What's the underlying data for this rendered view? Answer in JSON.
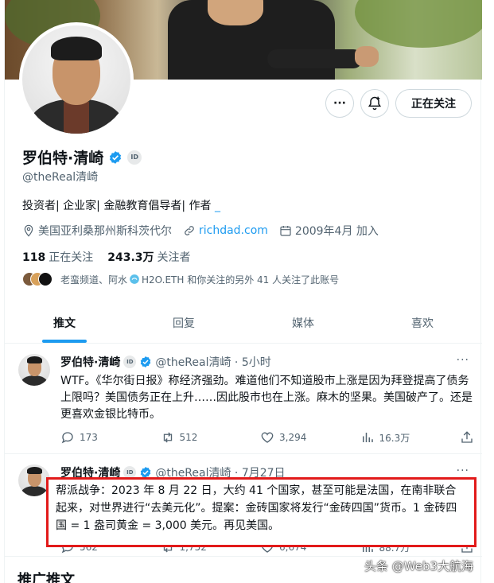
{
  "profile": {
    "name": "罗伯特·清崎",
    "id_badge": "ID",
    "handle": "@theReal清崎",
    "bio": "投资者| 企业家| 金融教育倡导者| 作者 ",
    "bio_link": "_",
    "location": "美国亚利桑那州斯科茨代尔",
    "website": "richdad.com",
    "joined": "2009年4月 加入",
    "following_count": "118",
    "following_label": "正在关注",
    "followers_count": "243.3万",
    "followers_label": "关注者",
    "followed_by": "老蛮频道、阿水",
    "followed_by_2": "H2O.ETH 和你关注的另外 41 人关注了此账号"
  },
  "actions": {
    "more_label": "···",
    "follow_label": "正在关注"
  },
  "tabs": [
    "推文",
    "回复",
    "媒体",
    "喜欢"
  ],
  "tweets": [
    {
      "name": "罗伯特·清崎",
      "handle": "@theReal清崎 · 5小时",
      "more": "···",
      "text": "WTF。《华尔街日报》称经济强劲。难道他们不知道股市上涨是因为拜登提高了债务上限吗？美国债务正在上升……因此股市也在上涨。麻木的坚果。美国破产了。还是更喜欢金银比特币。",
      "replies": "173",
      "retweets": "512",
      "likes": "3,294",
      "views": "16.3万"
    },
    {
      "name": "罗伯特·清崎",
      "handle": "@theReal清崎 · 7月27日",
      "more": "···",
      "text": "帮派战争：2023 年 8 月 22 日，大约 41 个国家，甚至可能是法国，在南非联合起来，对世界进行“去美元化”。提案：金砖国家将发行“金砖四国”货币。1 金砖四国 = 1 盎司黄金 = 3,000 美元。再见美国。",
      "replies": "562",
      "retweets": "1,752",
      "likes": "6,674",
      "views": "88.7万"
    }
  ],
  "next_section": "推广推文",
  "watermark": "头条 @Web3大航海",
  "colors": {
    "accent": "#1d9bf0",
    "highlight_border": "#e21a1a",
    "muted": "#536471"
  }
}
